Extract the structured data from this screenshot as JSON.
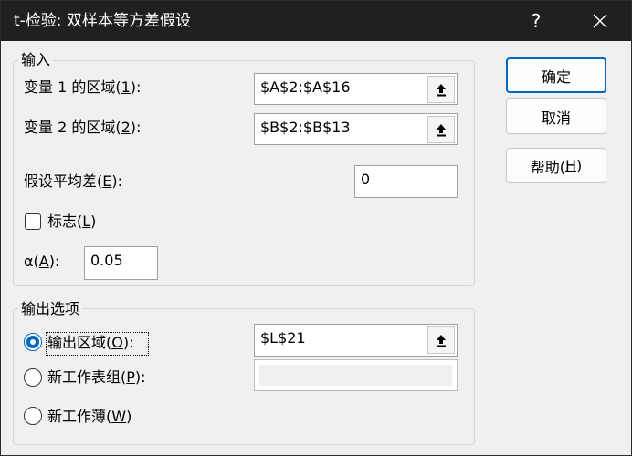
{
  "dialog": {
    "title": "t-检验: 双样本等方差假设",
    "help_glyph": "?",
    "close_glyph": "✕"
  },
  "input_group": {
    "legend": "输入",
    "range1": {
      "label_prefix": "变量 1 的区域(",
      "label_key": "1",
      "label_suffix": "):",
      "value": "$A$2:$A$16"
    },
    "range2": {
      "label_prefix": "变量 2 的区域(",
      "label_key": "2",
      "label_suffix": "):",
      "value": "$B$2:$B$13"
    },
    "mean_diff": {
      "label_prefix": "假设平均差(",
      "label_key": "E",
      "label_suffix": "):",
      "value": "0"
    },
    "labels_checkbox": {
      "label_prefix": "标志(",
      "label_key": "L",
      "label_suffix": ")",
      "checked": false
    },
    "alpha": {
      "label_prefix": "α(",
      "label_key": "A",
      "label_suffix": "):",
      "value": "0.05"
    }
  },
  "output_group": {
    "legend": "输出选项",
    "output_range": {
      "label_prefix": "输出区域(",
      "label_key": "O",
      "label_suffix": "):",
      "value": "$L$21",
      "selected": true
    },
    "new_sheet": {
      "label_prefix": "新工作表组(",
      "label_key": "P",
      "label_suffix": "):",
      "value": "",
      "selected": false
    },
    "new_workbook": {
      "label_prefix": "新工作薄(",
      "label_key": "W",
      "label_suffix": ")",
      "selected": false
    }
  },
  "buttons": {
    "ok": "确定",
    "cancel": "取消",
    "help_prefix": "帮助(",
    "help_key": "H",
    "help_suffix": ")"
  },
  "colors": {
    "accent": "#0067c0",
    "titlebar": "#202020"
  },
  "icons": {
    "ref_button": "arrow-up-collapse-icon"
  }
}
